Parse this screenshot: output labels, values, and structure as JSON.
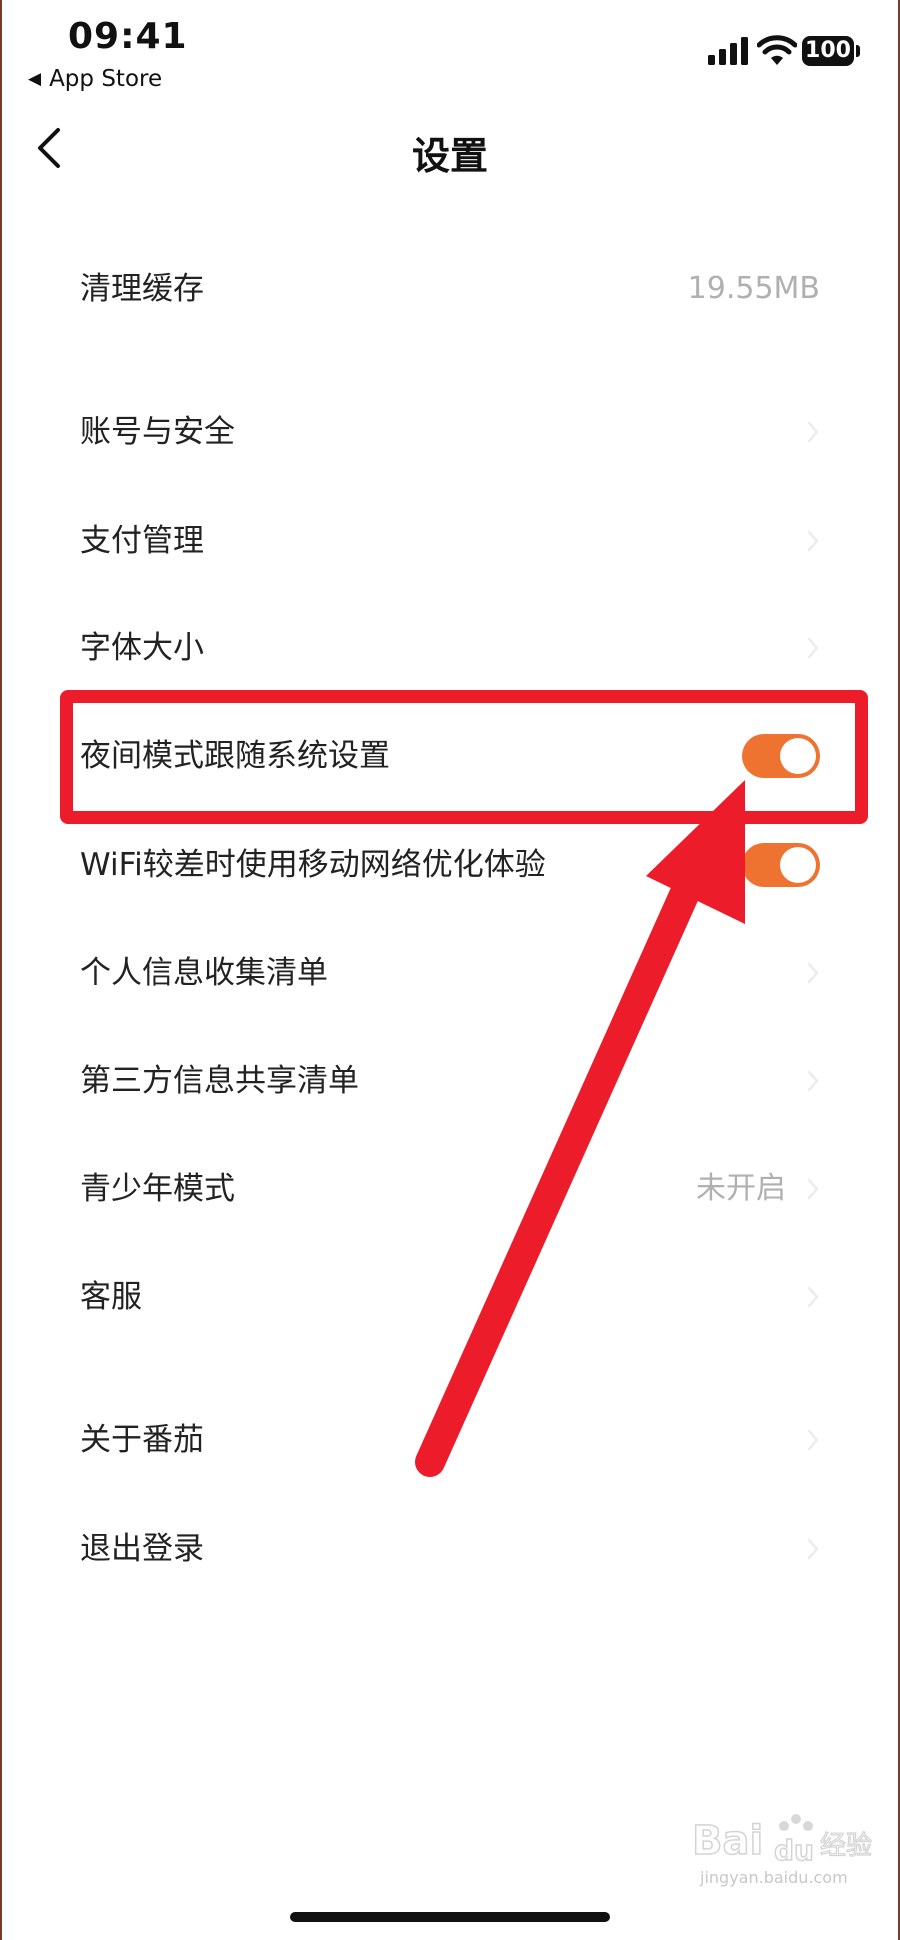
{
  "status_bar": {
    "time": "09:41",
    "back_app": "App Store",
    "battery": "100"
  },
  "nav": {
    "title": "设置"
  },
  "settings": {
    "clear_cache": {
      "label": "清理缓存",
      "value": "19.55MB"
    },
    "account_security": {
      "label": "账号与安全"
    },
    "payment": {
      "label": "支付管理"
    },
    "font_size": {
      "label": "字体大小"
    },
    "night_mode": {
      "label": "夜间模式跟随系统设置",
      "enabled": true
    },
    "wifi_optimize": {
      "label": "WiFi较差时使用移动网络优化体验",
      "enabled": true
    },
    "personal_info": {
      "label": "个人信息收集清单"
    },
    "third_party": {
      "label": "第三方信息共享清单"
    },
    "teen_mode": {
      "label": "青少年模式",
      "value": "未开启"
    },
    "customer_service": {
      "label": "客服"
    },
    "about": {
      "label": "关于番茄"
    },
    "logout": {
      "label": "退出登录"
    }
  },
  "colors": {
    "toggle_on": "#ee7330",
    "annotation": "#ec1c2a",
    "muted_text": "#b0b0b0"
  },
  "watermark": {
    "brand": "Baidu经验",
    "url": "jingyan.baidu.com"
  }
}
